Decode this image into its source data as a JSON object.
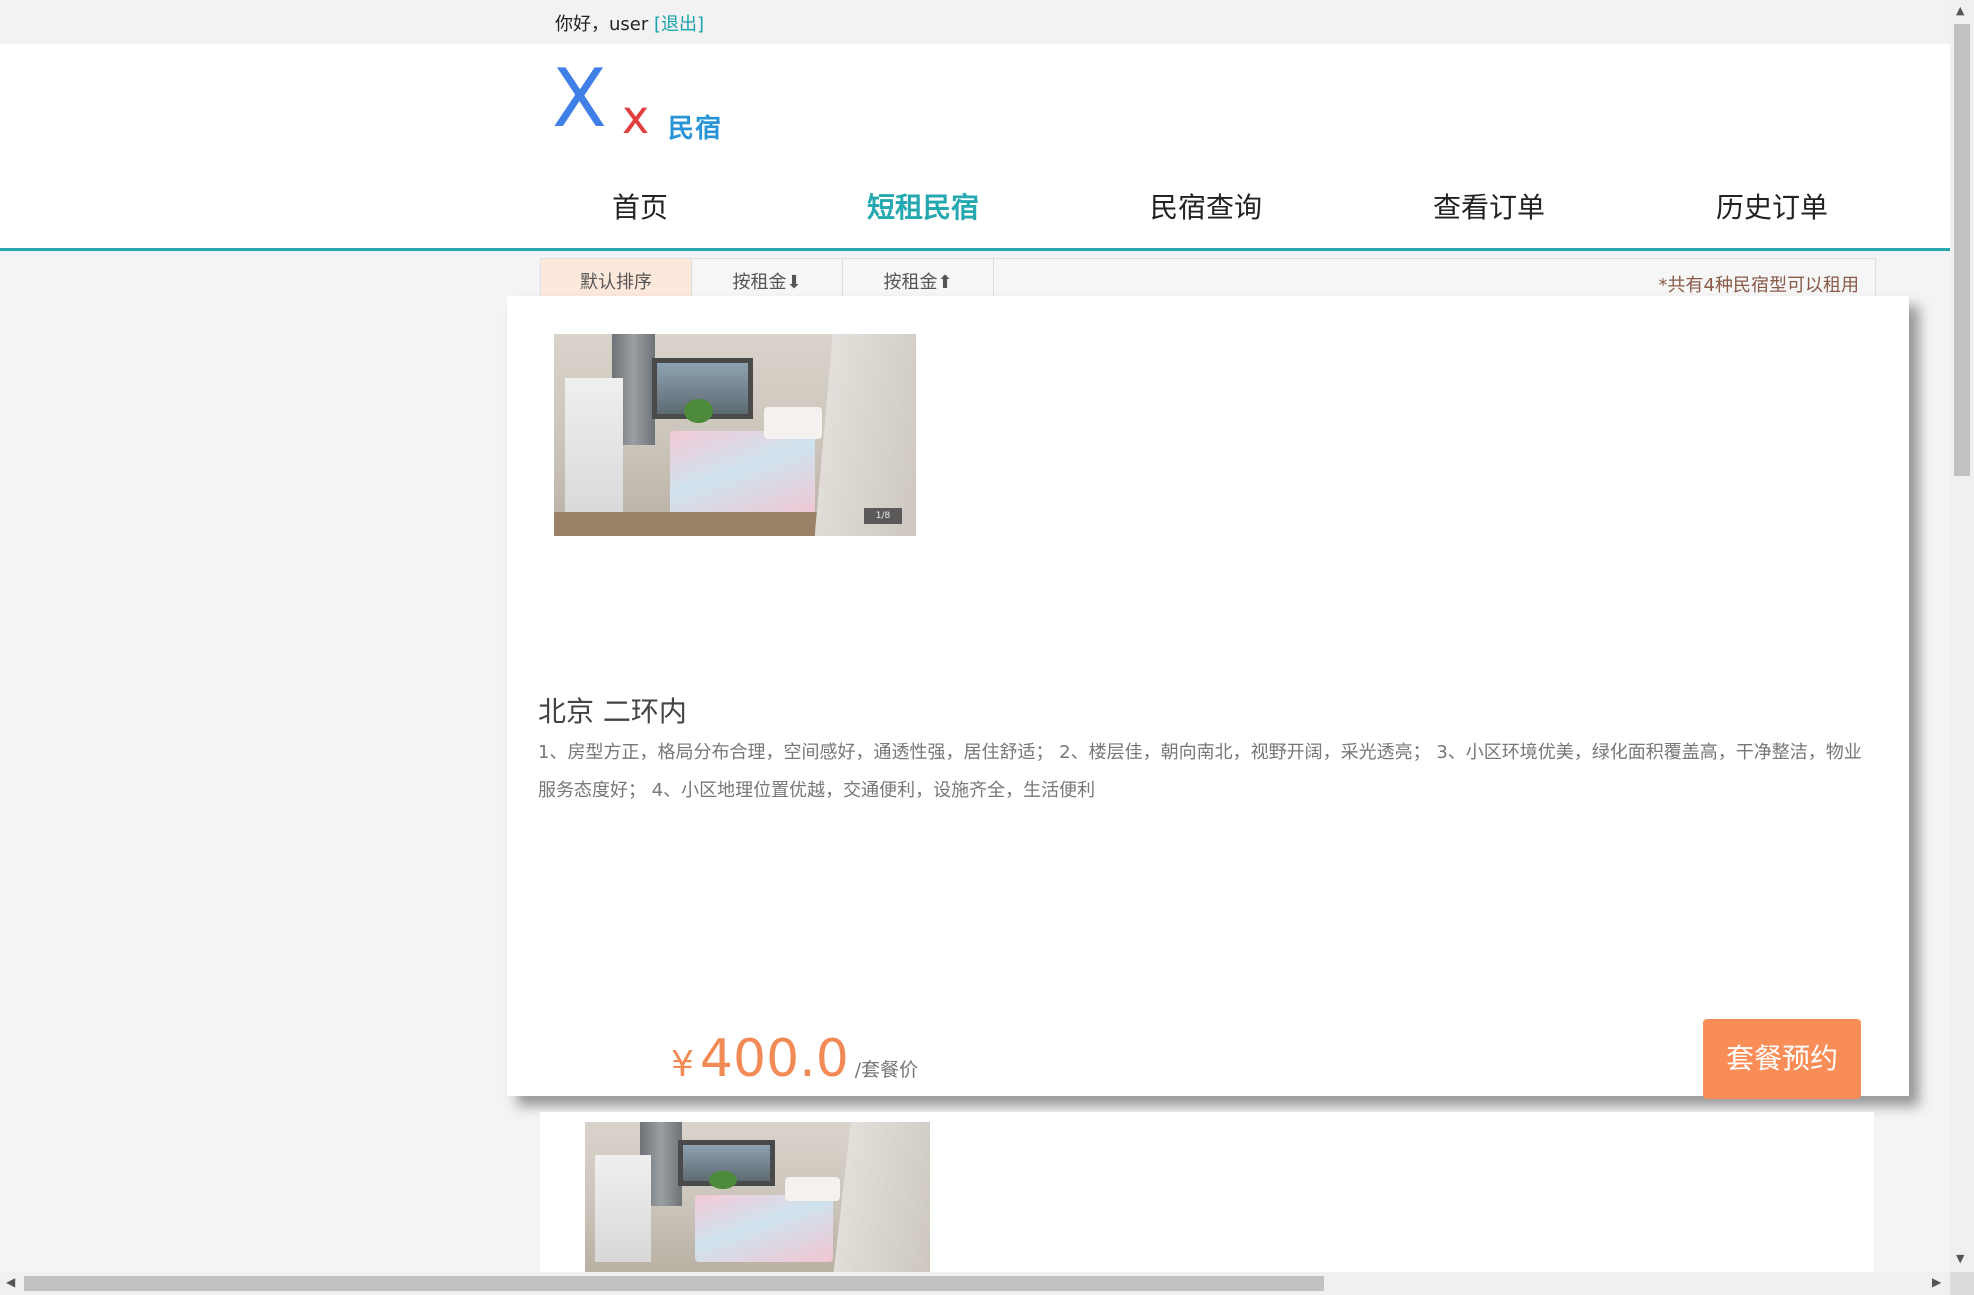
{
  "topbar": {
    "greeting": "你好，user",
    "logout_label": "[退出]"
  },
  "logo": {
    "big_letter": "X",
    "small_letter": "x",
    "name": "民宿"
  },
  "nav": {
    "items": [
      {
        "label": "首页",
        "active": false
      },
      {
        "label": "短租民宿",
        "active": true
      },
      {
        "label": "民宿查询",
        "active": false
      },
      {
        "label": "查看订单",
        "active": false
      },
      {
        "label": "历史订单",
        "active": false
      }
    ],
    "accent_color": "#26a8b0"
  },
  "sort": {
    "buttons": [
      "默认排序",
      "按租金⬇",
      "按租金⬆"
    ],
    "active_index": 0,
    "note": "*共有4种民宿型可以租用"
  },
  "listings": [
    {
      "title": "北京 二环内",
      "description": "1、房型方正，格局分布合理，空间感好，通透性强，居住舒适； 2、楼层佳，朝向南北，视野开阔，采光透亮； 3、小区环境优美，绿化面积覆盖高，干净整洁，物业服务态度好； 4、小区地理位置优越，交通便利，设施齐全，生活便利",
      "currency": "¥",
      "price": "400.0",
      "price_unit": "/套餐价",
      "book_label": "套餐预约",
      "image_counter": "1/8",
      "image_icon": "bedroom-photo"
    },
    {
      "image_icon": "bedroom-photo"
    }
  ],
  "colors": {
    "price": "#f28a56",
    "book_button": "#f98d57",
    "logo_x": "#3f7fe6",
    "logo_small_x": "#e23e3e"
  },
  "scrollbars": {
    "up_icon": "▲",
    "down_icon": "▼",
    "left_icon": "◀",
    "right_icon": "▶"
  }
}
